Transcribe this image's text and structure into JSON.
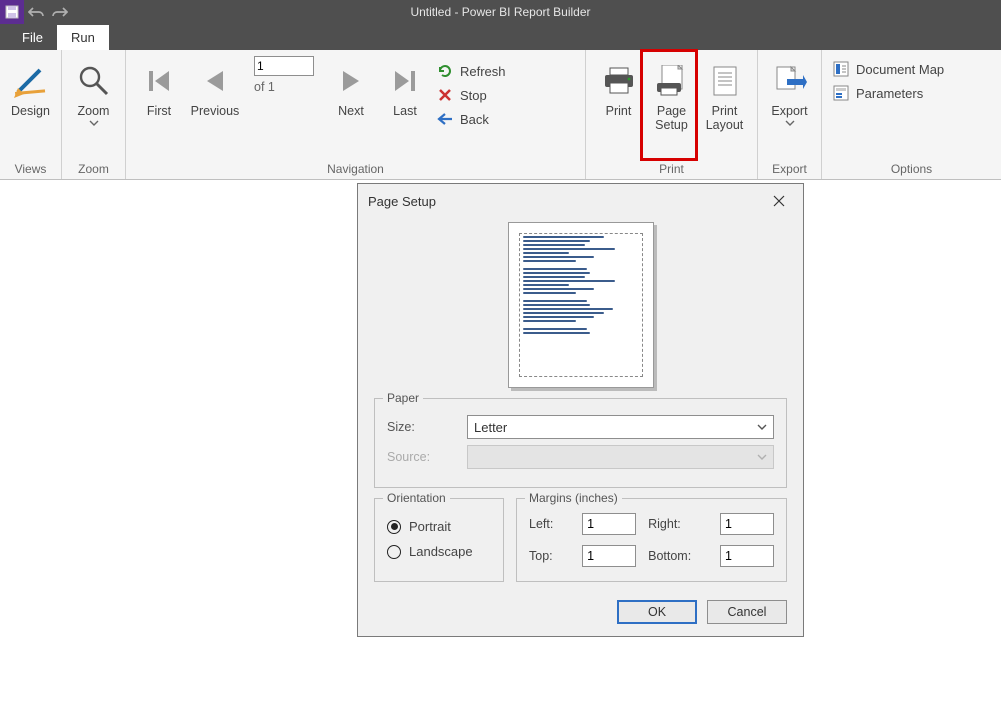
{
  "titlebar": {
    "title": "Untitled - Power BI Report Builder"
  },
  "tabs": {
    "file": "File",
    "run": "Run"
  },
  "ribbon": {
    "views": {
      "label": "Views",
      "design": "Design"
    },
    "zoom": {
      "label": "Zoom",
      "zoom": "Zoom"
    },
    "navigation": {
      "label": "Navigation",
      "first": "First",
      "previous": "Previous",
      "next": "Next",
      "last": "Last",
      "page_value": "1",
      "of_text": "of  1",
      "refresh": "Refresh",
      "stop": "Stop",
      "back": "Back"
    },
    "print": {
      "label": "Print",
      "print": "Print",
      "page_setup": "Page\nSetup",
      "print_layout": "Print\nLayout"
    },
    "export": {
      "label": "Export",
      "export": "Export"
    },
    "options": {
      "label": "Options",
      "document_map": "Document Map",
      "parameters": "Parameters"
    }
  },
  "dialog": {
    "title": "Page Setup",
    "paper": {
      "legend": "Paper",
      "size_label": "Size:",
      "size_value": "Letter",
      "source_label": "Source:"
    },
    "orientation": {
      "legend": "Orientation",
      "portrait": "Portrait",
      "landscape": "Landscape"
    },
    "margins": {
      "legend": "Margins (inches)",
      "left_label": "Left:",
      "right_label": "Right:",
      "top_label": "Top:",
      "bottom_label": "Bottom:",
      "left": "1",
      "right": "1",
      "top": "1",
      "bottom": "1"
    },
    "ok": "OK",
    "cancel": "Cancel"
  }
}
